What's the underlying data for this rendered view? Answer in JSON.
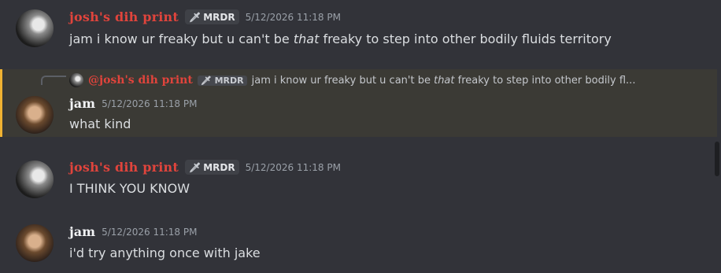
{
  "messages": [
    {
      "username": "josh's dih print",
      "tag": "MRDR",
      "timestamp": "5/12/2026 11:18 PM",
      "text_before": "jam i know ur freaky but u can't be ",
      "text_em": "that",
      "text_after": " freaky to step into other bodily fluids territory"
    },
    {
      "reply": {
        "username": "@josh's dih print",
        "tag": "MRDR",
        "text_before": "jam i know ur freaky but u can't be ",
        "text_em": "that",
        "text_after": " freaky to step into other bodily fl..."
      },
      "username": "jam",
      "timestamp": "5/12/2026 11:18 PM",
      "text": "what kind"
    },
    {
      "username": "josh's dih print",
      "tag": "MRDR",
      "timestamp": "5/12/2026 11:18 PM",
      "text": "I THINK YOU KNOW"
    },
    {
      "username": "jam",
      "timestamp": "5/12/2026 11:18 PM",
      "text": "i'd try anything once with jake"
    }
  ],
  "icons": {
    "tag_icon": "sword-icon",
    "reply_connector": "reply-connector-icon"
  },
  "colors": {
    "background": "#323339",
    "josh_name": "#e0443c",
    "mention_highlight": "#3b3a35",
    "mention_bar": "#f0b232"
  }
}
